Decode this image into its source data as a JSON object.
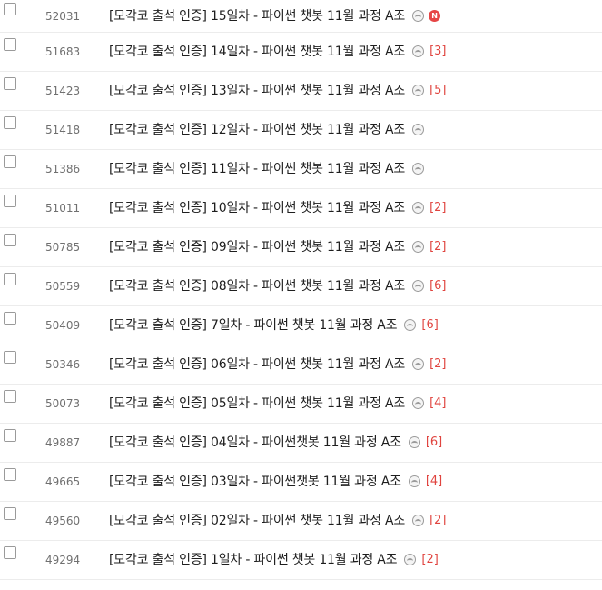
{
  "posts": [
    {
      "num": "52031",
      "title": "[모각코 출석 인증] 15일차 - 파이썬 챗봇 11월 과정 A조",
      "count": "",
      "new": "N"
    },
    {
      "num": "51683",
      "title": "[모각코 출석 인증] 14일차 - 파이썬 챗봇 11월 과정 A조",
      "count": "[3]",
      "new": ""
    },
    {
      "num": "51423",
      "title": "[모각코 출석 인증] 13일차 - 파이썬 챗봇 11월 과정 A조",
      "count": "[5]",
      "new": ""
    },
    {
      "num": "51418",
      "title": "[모각코 출석 인증] 12일차 - 파이썬 챗봇 11월 과정 A조",
      "count": "",
      "new": ""
    },
    {
      "num": "51386",
      "title": "[모각코 출석 인증] 11일차 - 파이썬 챗봇 11월 과정 A조",
      "count": "",
      "new": ""
    },
    {
      "num": "51011",
      "title": "[모각코 출석 인증] 10일차 - 파이썬 챗봇 11월 과정 A조",
      "count": "[2]",
      "new": ""
    },
    {
      "num": "50785",
      "title": "[모각코 출석 인증] 09일차 - 파이썬 챗봇 11월 과정 A조",
      "count": "[2]",
      "new": ""
    },
    {
      "num": "50559",
      "title": "[모각코 출석 인증] 08일차 - 파이썬 챗봇 11월 과정 A조",
      "count": "[6]",
      "new": ""
    },
    {
      "num": "50409",
      "title": "[모각코 출석 인증] 7일차 - 파이썬 챗봇 11월 과정 A조",
      "count": "[6]",
      "new": ""
    },
    {
      "num": "50346",
      "title": "[모각코 출석 인증] 06일차 - 파이썬 챗봇 11월 과정 A조",
      "count": "[2]",
      "new": ""
    },
    {
      "num": "50073",
      "title": "[모각코 출석 인증] 05일차 - 파이썬 챗봇 11월 과정 A조",
      "count": "[4]",
      "new": ""
    },
    {
      "num": "49887",
      "title": "[모각코 출석 인증] 04일차 - 파이썬챗봇 11월 과정 A조",
      "count": "[6]",
      "new": ""
    },
    {
      "num": "49665",
      "title": "[모각코 출석 인증] 03일차 - 파이썬챗봇 11월 과정 A조",
      "count": "[4]",
      "new": ""
    },
    {
      "num": "49560",
      "title": "[모각코 출석 인증] 02일차 - 파이썬 챗봇 11월 과정 A조",
      "count": "[2]",
      "new": ""
    },
    {
      "num": "49294",
      "title": "[모각코 출석 인증] 1일차 - 파이썬 챗봇 11월 과정 A조",
      "count": "[2]",
      "new": ""
    }
  ],
  "icons": {
    "attachment": "image-icon",
    "new": "new-badge"
  },
  "colors": {
    "comment_count": "#e0443f",
    "new_badge": "#e64545",
    "text": "#1e1e1e",
    "number": "#707070"
  }
}
